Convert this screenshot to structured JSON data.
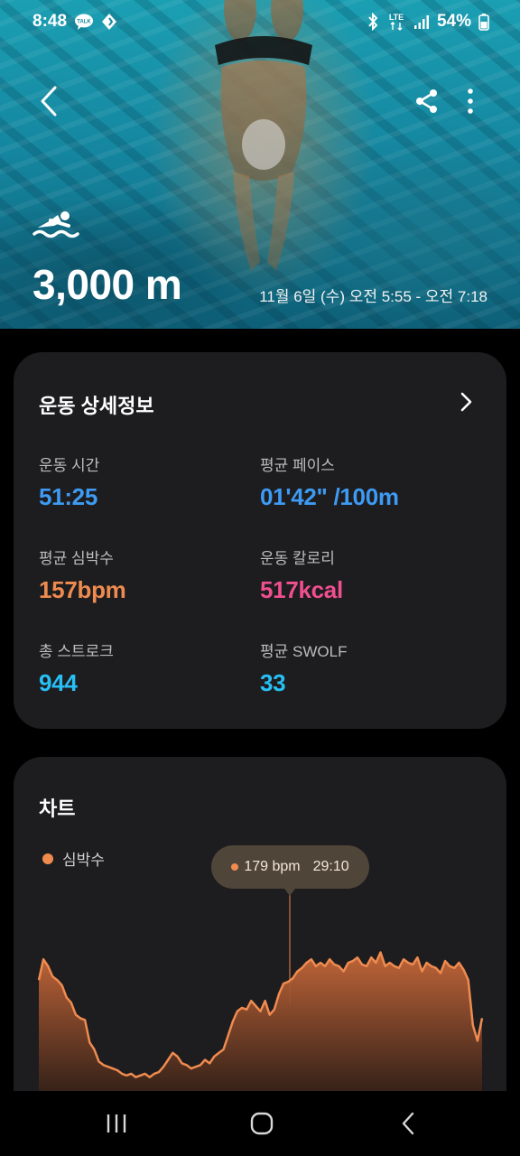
{
  "status_bar": {
    "time": "8:48",
    "battery": "54%",
    "network": "LTE"
  },
  "workout": {
    "distance": "3,000 m",
    "date_range": "11월 6일 (수) 오전 5:55 - 오전 7:18"
  },
  "details": {
    "title": "운동 상세정보",
    "stats": [
      {
        "label": "운동 시간",
        "value": "51:25",
        "unit": ""
      },
      {
        "label": "평균 페이스",
        "value": "01'42\" /100m",
        "unit": ""
      },
      {
        "label": "평균 심박수",
        "value": "157",
        "unit": "bpm"
      },
      {
        "label": "운동 칼로리",
        "value": "517",
        "unit": "kcal"
      },
      {
        "label": "총 스트로크",
        "value": "944",
        "unit": ""
      },
      {
        "label": "평균 SWOLF",
        "value": "33",
        "unit": ""
      }
    ]
  },
  "chart": {
    "title": "차트",
    "legend": "심박수",
    "tooltip_value": "179 bpm",
    "tooltip_time": "29:10"
  },
  "colors": {
    "time": "#3d9bf4",
    "heart": "#ef8b4f",
    "calorie": "#ef4f8f",
    "stroke": "#27c0f5"
  },
  "chart_data": {
    "type": "area",
    "title": "",
    "series": [
      {
        "name": "심박수",
        "values": [
          150,
          162,
          158,
          152,
          150,
          147,
          140,
          137,
          130,
          128,
          127,
          114,
          110,
          103,
          101,
          100,
          99,
          98,
          96,
          95,
          96,
          94,
          95,
          96,
          94,
          96,
          97,
          100,
          104,
          108,
          106,
          102,
          101,
          99,
          100,
          101,
          104,
          102,
          106,
          108,
          110,
          118,
          126,
          132,
          134,
          133,
          138,
          135,
          132,
          138,
          130,
          133,
          142,
          148,
          149,
          151,
          155,
          157,
          160,
          162,
          158,
          160,
          158,
          162,
          159,
          158,
          155,
          160,
          161,
          163,
          159,
          158,
          163,
          160,
          166,
          158,
          160,
          158,
          157,
          162,
          160,
          159,
          163,
          155,
          160,
          158,
          157,
          154,
          161,
          158,
          157,
          160,
          156,
          150,
          124,
          115,
          128
        ]
      }
    ],
    "tooltip": {
      "x": "29:10",
      "y": 179,
      "unit": "bpm"
    },
    "grid": false
  }
}
